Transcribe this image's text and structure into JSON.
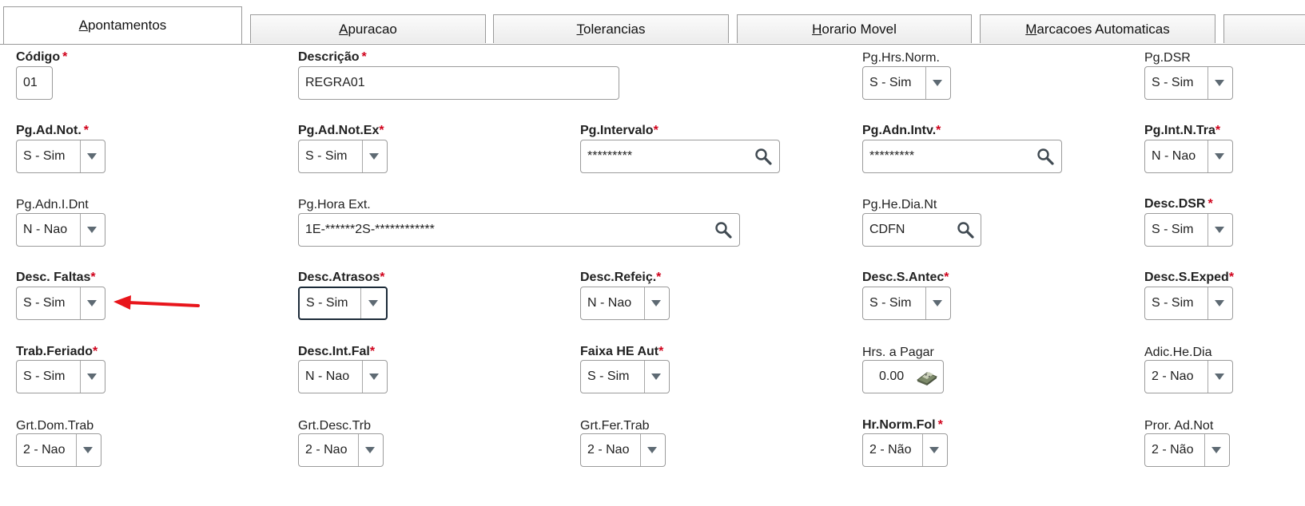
{
  "tabs": [
    {
      "label": "Apontamentos"
    },
    {
      "label": "Apuracao"
    },
    {
      "label": "Tolerancias"
    },
    {
      "label": "Horario Movel"
    },
    {
      "label": "Marcacoes Automaticas"
    }
  ],
  "fields": {
    "codigo": {
      "label": "Código",
      "value": "01"
    },
    "descricao": {
      "label": "Descrição",
      "value": "REGRA01"
    },
    "pg_hrs_norm": {
      "label": "Pg.Hrs.Norm.",
      "value": "S - Sim"
    },
    "pg_dsr": {
      "label": "Pg.DSR",
      "value": "S - Sim"
    },
    "pg_ad_not": {
      "label": "Pg.Ad.Not.",
      "value": "S - Sim"
    },
    "pg_ad_not_ex": {
      "label": "Pg.Ad.Not.Ex",
      "value": "S - Sim"
    },
    "pg_intervalo": {
      "label": "Pg.Intervalo",
      "value": "*********"
    },
    "pg_adn_intv": {
      "label": "Pg.Adn.Intv.",
      "value": "*********"
    },
    "pg_int_n_tra": {
      "label": "Pg.Int.N.Tra",
      "value": "N - Nao"
    },
    "pg_adn_i_dnt": {
      "label": "Pg.Adn.I.Dnt",
      "value": "N - Nao"
    },
    "pg_hora_ext": {
      "label": "Pg.Hora Ext.",
      "value": "1E-******2S-************"
    },
    "pg_he_dia_nt": {
      "label": "Pg.He.Dia.Nt",
      "value": "CDFN"
    },
    "desc_dsr": {
      "label": "Desc.DSR",
      "value": "S - Sim"
    },
    "desc_faltas": {
      "label": "Desc. Faltas",
      "value": "S - Sim"
    },
    "desc_atrasos": {
      "label": "Desc.Atrasos",
      "value": "S - Sim"
    },
    "desc_refeic": {
      "label": "Desc.Refeiç.",
      "value": "N - Nao"
    },
    "desc_s_antec": {
      "label": "Desc.S.Antec",
      "value": "S - Sim"
    },
    "desc_s_exped": {
      "label": "Desc.S.Exped",
      "value": "S - Sim"
    },
    "trab_feriado": {
      "label": "Trab.Feriado",
      "value": "S - Sim"
    },
    "desc_int_fal": {
      "label": "Desc.Int.Fal",
      "value": "N - Nao"
    },
    "faixa_he_aut": {
      "label": "Faixa HE Aut",
      "value": "S - Sim"
    },
    "hrs_a_pagar": {
      "label": "Hrs. a Pagar",
      "value": "0.00"
    },
    "adic_he_dia": {
      "label": "Adic.He.Dia",
      "value": "2 - Nao"
    },
    "grt_dom_trab": {
      "label": "Grt.Dom.Trab",
      "value": "2 - Nao"
    },
    "grt_desc_trb": {
      "label": "Grt.Desc.Trb",
      "value": "2 - Nao"
    },
    "grt_fer_trab": {
      "label": "Grt.Fer.Trab",
      "value": "2 - Nao"
    },
    "hr_norm_fol": {
      "label": "Hr.Norm.Fol",
      "value": "2 - Não"
    },
    "pror_ad_not": {
      "label": "Pror. Ad.Not",
      "value": "2 - Não"
    }
  },
  "required_marker": "*",
  "colors": {
    "required": "#d0021b",
    "annotation_arrow": "#e8151b",
    "focus_border": "#1c2b39"
  }
}
